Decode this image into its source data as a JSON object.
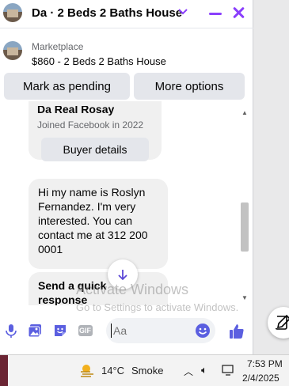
{
  "header": {
    "title": "Da · 2 Beds 2 Baths House",
    "icons": [
      "listing-thumbnail",
      "chevron-down-icon",
      "minimize-icon",
      "close-icon"
    ]
  },
  "listing": {
    "source": "Marketplace",
    "description": "$860 - 2 Beds 2 Baths House"
  },
  "actions": {
    "pending_label": "Mark as pending",
    "more_label": "More options"
  },
  "messages": {
    "profile_name": "Da Real Rosay",
    "joined": "Joined Facebook in 2022",
    "buyer_button": "Buyer details",
    "message_text": "Hi my name is Roslyn Fernandez. I'm very interested. You can contact me at 312 200 0001",
    "quick_response": "Send a quick response"
  },
  "composer": {
    "placeholder": "Aa",
    "icons": [
      "microphone-icon",
      "photo-icon",
      "sticker-icon",
      "gif-icon",
      "emoji-icon",
      "thumbs-up-icon"
    ],
    "gif_label": "GIF"
  },
  "watermark": {
    "line1": "Activate Windows",
    "line2": "Go to Settings to activate Windows."
  },
  "taskbar": {
    "temperature": "14°C",
    "condition": "Smoke",
    "time": "7:53 PM",
    "date": "2/4/2025"
  },
  "colors": {
    "accent": "#8a3ffc",
    "messenger_blue": "#5b5fe0",
    "bubble": "#f0f0f0",
    "button": "#e4e6eb"
  }
}
